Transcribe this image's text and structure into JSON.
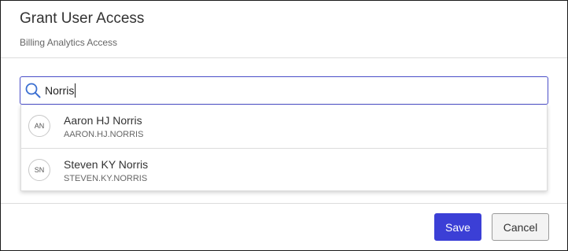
{
  "dialog": {
    "title": "Grant User Access",
    "subtitle": "Billing Analytics Access"
  },
  "search": {
    "value": "Norris",
    "icon": "search-icon",
    "border_color": "#4a4ec8"
  },
  "results": [
    {
      "initials": "AN",
      "name": "Aaron HJ Norris",
      "username": "AARON.HJ.NORRIS"
    },
    {
      "initials": "SN",
      "name": "Steven KY Norris",
      "username": "STEVEN.KY.NORRIS"
    }
  ],
  "footer": {
    "save_label": "Save",
    "cancel_label": "Cancel",
    "save_color": "#3b3fd6"
  }
}
